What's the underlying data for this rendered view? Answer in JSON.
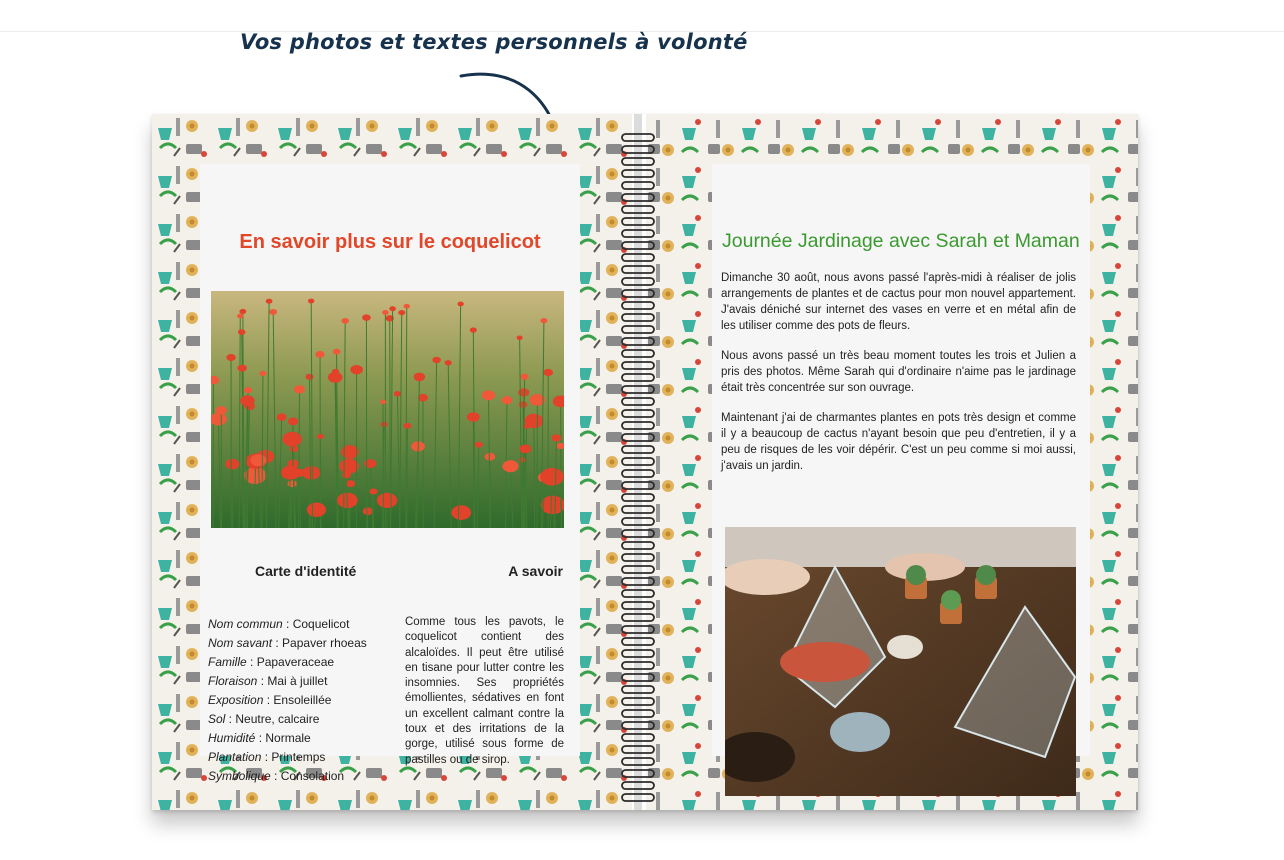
{
  "caption": "Vos photos et textes personnels à volonté",
  "left_page": {
    "title": "En savoir plus sur le coquelicot",
    "identity_heading": "Carte d'identité",
    "know_heading": "A savoir",
    "facts": [
      {
        "key": "Nom commun",
        "value": "Coquelicot"
      },
      {
        "key": "Nom savant",
        "value": "Papaver rhoeas"
      },
      {
        "key": "Famille",
        "value": "Papaveraceae"
      },
      {
        "key": "Floraison",
        "value": "Mai à juillet"
      },
      {
        "key": "Exposition",
        "value": "Ensoleillée"
      },
      {
        "key": "Sol",
        "value": "Neutre, calcaire"
      },
      {
        "key": "Humidité",
        "value": "Normale"
      },
      {
        "key": "Plantation",
        "value": "Printemps"
      },
      {
        "key": "Symbolique",
        "value": "Consolation"
      }
    ],
    "know_text": "Comme tous les pavots, le coquelicot contient des alcaloïdes. Il peut être utilisé en tisane pour lutter contre les insomnies. Ses propriétés émollientes, sédatives en font un excellent calmant contre la toux et des irritations de la gorge, utilisé sous forme de pastilles ou de sirop."
  },
  "right_page": {
    "title": "Journée Jardinage avec Sarah et Maman",
    "paragraphs": [
      "Dimanche 30 août, nous avons passé l'après-midi à réaliser de jolis arrangements de plantes et de cactus pour mon nouvel appartement. J'avais déniché sur internet des vases en verre et en métal afin de les utiliser comme des pots de fleurs.",
      "Nous avons passé un très beau moment toutes les trois et Julien a pris des photos. Même Sarah qui d'ordinaire n'aime pas le jardinage était très concentrée sur son ouvrage.",
      "Maintenant j'ai de charmantes plantes en pots très design et comme il y a beaucoup de cactus n'ayant besoin que peu d'entretien, il y a peu de risques de les voir dépérir. C'est un peu comme si moi aussi, j'avais un jardin."
    ]
  },
  "colors": {
    "left_title": "#e2472a",
    "right_title": "#3a9a2f",
    "caption": "#17324d"
  }
}
